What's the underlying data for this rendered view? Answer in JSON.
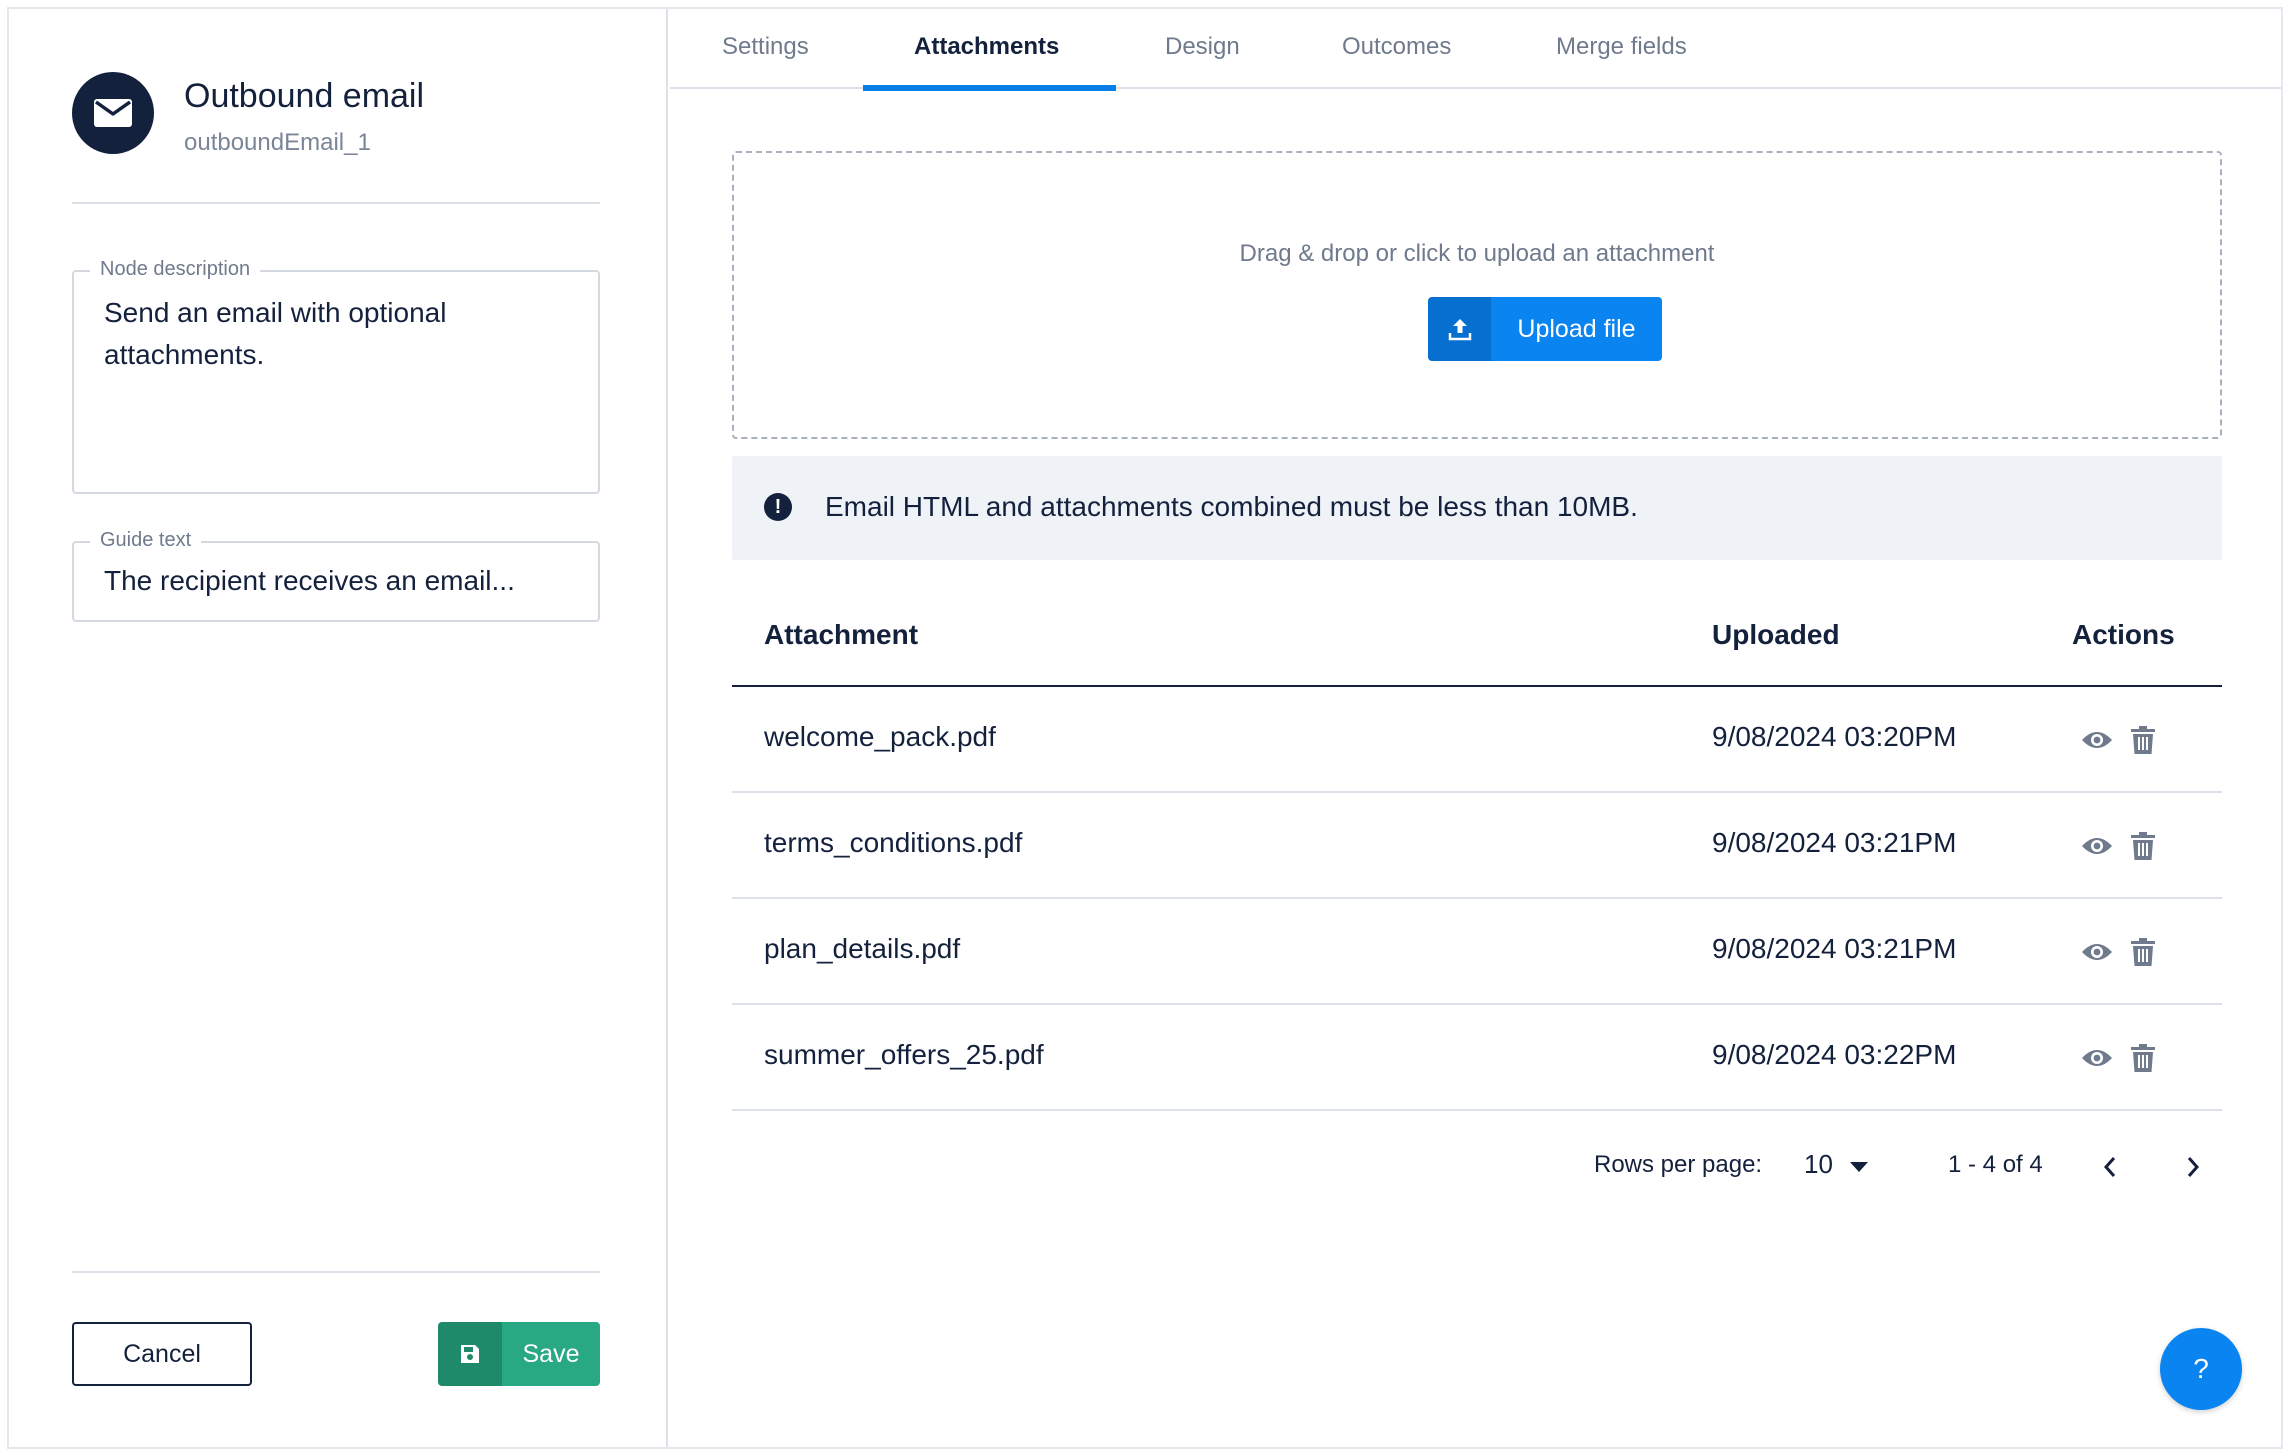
{
  "node": {
    "title": "Outbound email",
    "id": "outboundEmail_1",
    "icon": "envelope-icon"
  },
  "fields": {
    "description": {
      "label": "Node description",
      "value": "Send an email with optional attachments."
    },
    "guide": {
      "label": "Guide text",
      "value": "The recipient receives an email..."
    }
  },
  "buttons": {
    "cancel": "Cancel",
    "save": "Save"
  },
  "tabs": [
    {
      "label": "Settings",
      "active": false
    },
    {
      "label": "Attachments",
      "active": true
    },
    {
      "label": "Design",
      "active": false
    },
    {
      "label": "Outcomes",
      "active": false
    },
    {
      "label": "Merge fields",
      "active": false
    }
  ],
  "upload": {
    "prompt": "Drag & drop or click to upload an attachment",
    "button": "Upload file"
  },
  "info": {
    "text": "Email HTML and attachments combined must be less than 10MB."
  },
  "table": {
    "headers": {
      "attachment": "Attachment",
      "uploaded": "Uploaded",
      "actions": "Actions"
    },
    "rows": [
      {
        "name": "welcome_pack.pdf",
        "uploaded": "9/08/2024 03:20PM"
      },
      {
        "name": "terms_conditions.pdf",
        "uploaded": "9/08/2024 03:21PM"
      },
      {
        "name": "plan_details.pdf",
        "uploaded": "9/08/2024 03:21PM"
      },
      {
        "name": "summer_offers_25.pdf",
        "uploaded": "9/08/2024 03:22PM"
      }
    ]
  },
  "pagination": {
    "rows_per_page_label": "Rows per page:",
    "rows_per_page_value": "10",
    "range": "1 - 4 of 4"
  },
  "help": "?",
  "colors": {
    "navy": "#14213d",
    "accent": "#0a84f0",
    "save_green": "#28a883"
  }
}
